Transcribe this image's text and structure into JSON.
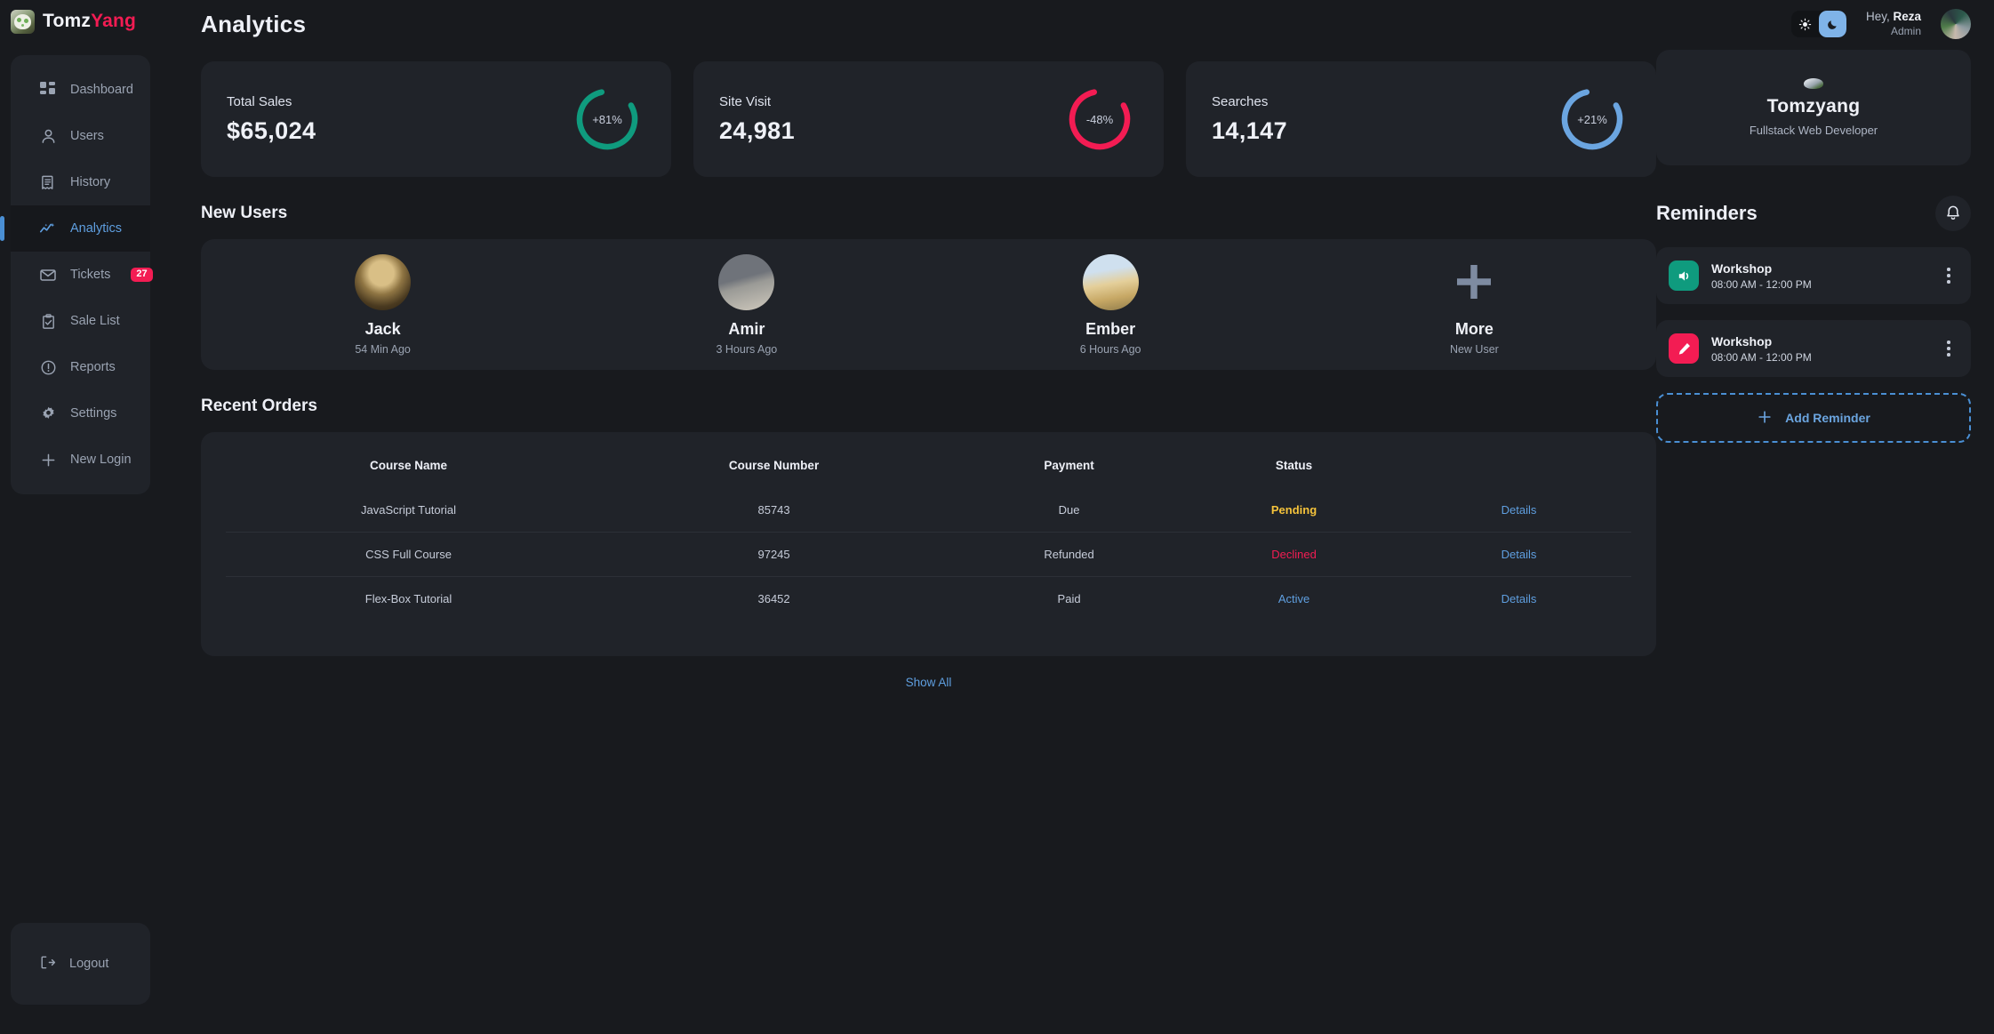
{
  "brand": {
    "name_part1": "Tomz",
    "name_part2": "Yang",
    "logo_icon": "app-logo-icon"
  },
  "sidebar": {
    "items": [
      {
        "label": "Dashboard",
        "icon": "dashboard-grid-icon",
        "active": false
      },
      {
        "label": "Users",
        "icon": "user-icon",
        "active": false
      },
      {
        "label": "History",
        "icon": "history-list-icon",
        "active": false
      },
      {
        "label": "Analytics",
        "icon": "analytics-chart-icon",
        "active": true
      },
      {
        "label": "Tickets",
        "icon": "mail-envelope-icon",
        "active": false,
        "badge": "27"
      },
      {
        "label": "Sale List",
        "icon": "clipboard-check-icon",
        "active": false
      },
      {
        "label": "Reports",
        "icon": "alert-circle-icon",
        "active": false
      },
      {
        "label": "Settings",
        "icon": "gear-icon",
        "active": false
      },
      {
        "label": "New Login",
        "icon": "plus-icon",
        "active": false
      }
    ],
    "logout": {
      "label": "Logout",
      "icon": "logout-arrow-icon"
    }
  },
  "header": {
    "page_title": "Analytics",
    "theme": {
      "light_icon": "sun-icon",
      "dark_icon": "moon-icon",
      "active": "dark"
    },
    "greeting_prefix": "Hey, ",
    "user_name": "Reza",
    "user_role": "Admin",
    "avatar": "user-avatar"
  },
  "stats": [
    {
      "label": "Total Sales",
      "value": "$65,024",
      "delta": "+81%",
      "percent": 81,
      "color": "#0f9b7e"
    },
    {
      "label": "Site Visit",
      "value": "24,981",
      "delta": "-48%",
      "percent": 48,
      "color": "#f31c53"
    },
    {
      "label": "Searches",
      "value": "14,147",
      "delta": "+21%",
      "percent": 21,
      "color": "#6ba5e0"
    }
  ],
  "profile": {
    "name": "Tomzyang",
    "role": "Fullstack Web Developer",
    "thumb": "profile-thumbnail"
  },
  "new_users": {
    "title": "New Users",
    "items": [
      {
        "name": "Jack",
        "time": "54 Min Ago",
        "avatar_class": "img-a"
      },
      {
        "name": "Amir",
        "time": "3 Hours Ago",
        "avatar_class": "img-b"
      },
      {
        "name": "Ember",
        "time": "6 Hours Ago",
        "avatar_class": "img-c"
      }
    ],
    "more": {
      "name": "More",
      "time": "New User",
      "icon": "plus-icon"
    }
  },
  "recent_orders": {
    "title": "Recent Orders",
    "columns": [
      "Course Name",
      "Course Number",
      "Payment",
      "Status",
      ""
    ],
    "rows": [
      {
        "course": "JavaScript Tutorial",
        "number": "85743",
        "payment": "Due",
        "status": "Pending",
        "status_class": "s-pending",
        "details": "Details"
      },
      {
        "course": "CSS Full Course",
        "number": "97245",
        "payment": "Refunded",
        "status": "Declined",
        "status_class": "s-declined",
        "details": "Details"
      },
      {
        "course": "Flex-Box Tutorial",
        "number": "36452",
        "payment": "Paid",
        "status": "Active",
        "status_class": "s-active",
        "details": "Details"
      }
    ],
    "show_all": "Show All"
  },
  "reminders": {
    "title": "Reminders",
    "bell_icon": "bell-icon",
    "items": [
      {
        "name": "Workshop",
        "time": "08:00 AM - 12:00 PM",
        "icon": "speaker-icon",
        "color": "#0f9b7e",
        "menu_icon": "more-vertical-icon"
      },
      {
        "name": "Workshop",
        "time": "08:00 AM - 12:00 PM",
        "icon": "pencil-icon",
        "color": "#f31c53",
        "menu_icon": "more-vertical-icon"
      }
    ],
    "add_label": "Add Reminder",
    "add_icon": "plus-icon"
  }
}
